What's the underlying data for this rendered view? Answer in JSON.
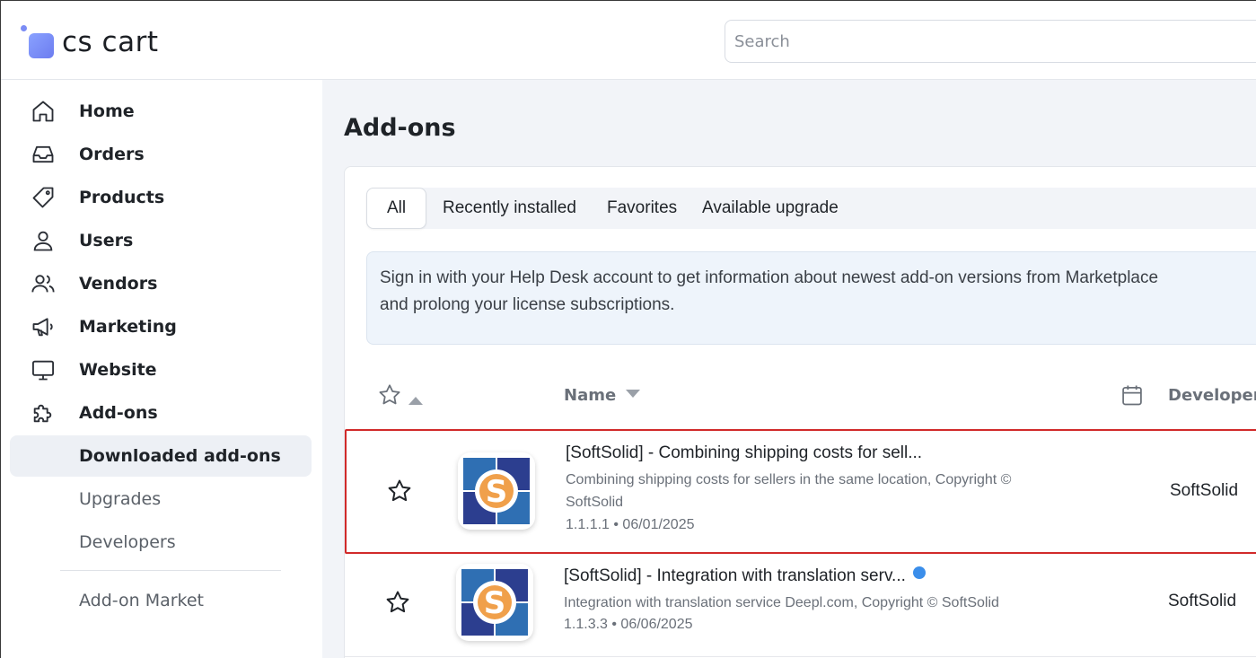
{
  "brand": {
    "name": "cs cart"
  },
  "search": {
    "placeholder": "Search"
  },
  "sidebar": {
    "items": [
      {
        "label": "Home",
        "icon": "home-icon"
      },
      {
        "label": "Orders",
        "icon": "inbox-icon"
      },
      {
        "label": "Products",
        "icon": "tag-icon"
      },
      {
        "label": "Users",
        "icon": "user-icon"
      },
      {
        "label": "Vendors",
        "icon": "users-icon"
      },
      {
        "label": "Marketing",
        "icon": "megaphone-icon"
      },
      {
        "label": "Website",
        "icon": "monitor-icon"
      },
      {
        "label": "Add-ons",
        "icon": "puzzle-icon"
      }
    ],
    "subitems": [
      {
        "label": "Downloaded add-ons",
        "active": true
      },
      {
        "label": "Upgrades"
      },
      {
        "label": "Developers"
      },
      {
        "label": "Add-on Market"
      }
    ]
  },
  "main": {
    "title": "Add-ons",
    "tabs": [
      {
        "label": "All",
        "active": true
      },
      {
        "label": "Recently installed"
      },
      {
        "label": "Favorites"
      },
      {
        "label": "Available upgrade"
      }
    ],
    "notice": {
      "line1": "Sign in with your Help Desk account to get information about newest add-on versions from Marketplace",
      "line2": "and prolong your license subscriptions."
    },
    "table": {
      "col_name": "Name",
      "col_developer": "Developer",
      "rows": [
        {
          "title": "[SoftSolid] - Combining shipping costs for sell...",
          "desc_line1": "Combining shipping costs for sellers in the same location, Copyright ©",
          "desc_line2": "SoftSolid",
          "version": "1.1.1.1 • 06/01/2025",
          "developer": "SoftSolid",
          "highlighted": true
        },
        {
          "title": "[SoftSolid] - Integration with translation serv...",
          "desc_line1": "Integration with translation service Deepl.com, Copyright © SoftSolid",
          "version": "1.1.3.3 • 06/06/2025",
          "developer": "SoftSolid",
          "has_update_dot": true
        }
      ]
    }
  },
  "colors": {
    "highlight_border": "#d12a2a",
    "accent_blue": "#3b8eea",
    "logo_orange": "#f0a04b",
    "logo_navy": "#2c3e8f"
  }
}
